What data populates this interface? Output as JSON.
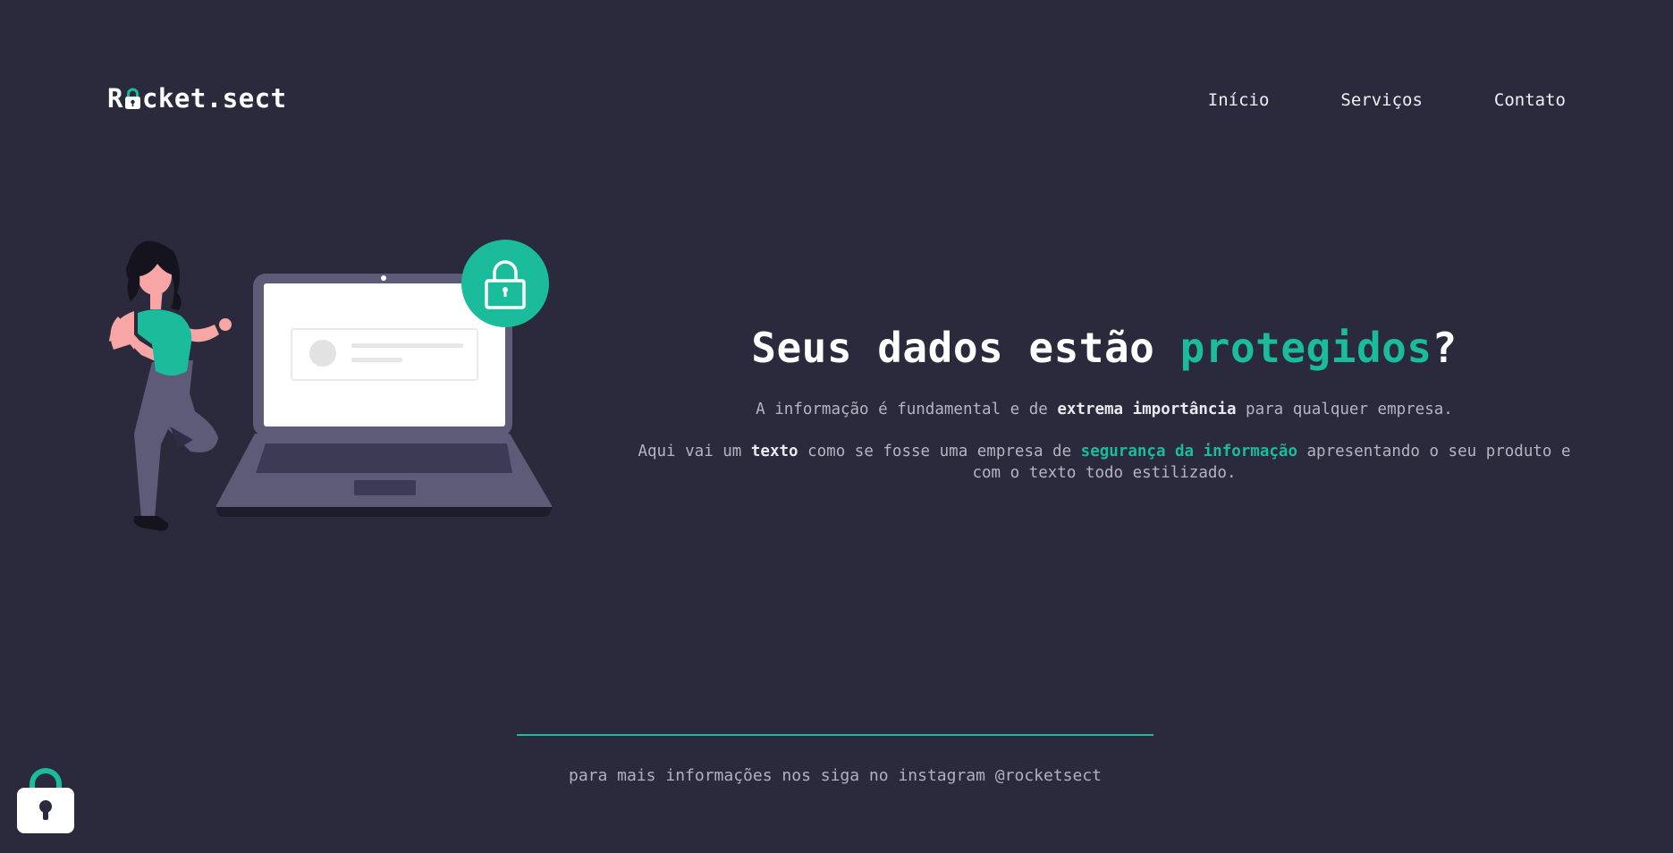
{
  "header": {
    "logo_prefix": "R",
    "logo_suffix": "cket.sect",
    "nav": [
      {
        "label": "Início"
      },
      {
        "label": "Serviços"
      },
      {
        "label": "Contato"
      }
    ]
  },
  "hero": {
    "title_main": "Seus dados estão ",
    "title_accent": "protegidos",
    "title_end": "?",
    "p1_a": "A informação é fundamental e de ",
    "p1_bold": "extrema importância",
    "p1_b": " para qualquer empresa.",
    "p2_a": "Aqui vai um ",
    "p2_bold": "texto",
    "p2_b": " como se fosse uma empresa de ",
    "p2_accent": "segurança da informação",
    "p2_c": " apresentando o seu produto e com o texto todo estilizado."
  },
  "footer": {
    "text": "para mais informações nos siga no instagram @rocketsect"
  },
  "colors": {
    "background": "#2b2a3d",
    "accent": "#1abc9c",
    "text": "#ffffff",
    "muted": "#b4b4c2"
  },
  "icons": [
    "padlock-icon",
    "laptop-illustration",
    "woman-illustration",
    "lock-badge-icon"
  ]
}
